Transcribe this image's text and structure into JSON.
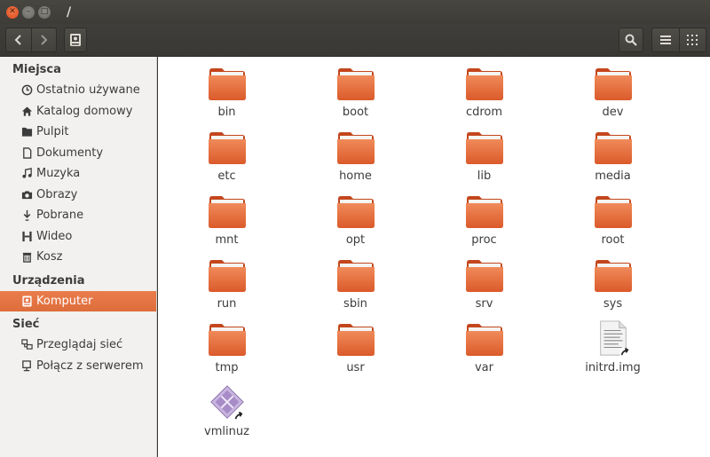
{
  "window": {
    "title": "/"
  },
  "sidebar": {
    "sections": [
      {
        "header": "Miejsca",
        "items": [
          {
            "label": "Ostatnio używane",
            "icon": "recent-icon"
          },
          {
            "label": "Katalog domowy",
            "icon": "home-icon"
          },
          {
            "label": "Pulpit",
            "icon": "desktop-folder-icon"
          },
          {
            "label": "Dokumenty",
            "icon": "document-icon"
          },
          {
            "label": "Muzyka",
            "icon": "music-icon"
          },
          {
            "label": "Obrazy",
            "icon": "camera-icon"
          },
          {
            "label": "Pobrane",
            "icon": "download-icon"
          },
          {
            "label": "Wideo",
            "icon": "video-icon"
          },
          {
            "label": "Kosz",
            "icon": "trash-icon"
          }
        ]
      },
      {
        "header": "Urządzenia",
        "items": [
          {
            "label": "Komputer",
            "icon": "computer-icon",
            "active": true
          }
        ]
      },
      {
        "header": "Sieć",
        "items": [
          {
            "label": "Przeglądaj sieć",
            "icon": "network-icon"
          },
          {
            "label": "Połącz z serwerem",
            "icon": "server-connect-icon"
          }
        ]
      }
    ]
  },
  "files": [
    {
      "name": "bin",
      "type": "folder"
    },
    {
      "name": "boot",
      "type": "folder"
    },
    {
      "name": "cdrom",
      "type": "folder"
    },
    {
      "name": "dev",
      "type": "folder"
    },
    {
      "name": "etc",
      "type": "folder"
    },
    {
      "name": "home",
      "type": "folder"
    },
    {
      "name": "lib",
      "type": "folder"
    },
    {
      "name": "media",
      "type": "folder"
    },
    {
      "name": "mnt",
      "type": "folder"
    },
    {
      "name": "opt",
      "type": "folder"
    },
    {
      "name": "proc",
      "type": "folder"
    },
    {
      "name": "root",
      "type": "folder"
    },
    {
      "name": "run",
      "type": "folder"
    },
    {
      "name": "sbin",
      "type": "folder"
    },
    {
      "name": "srv",
      "type": "folder"
    },
    {
      "name": "sys",
      "type": "folder"
    },
    {
      "name": "tmp",
      "type": "folder"
    },
    {
      "name": "usr",
      "type": "folder"
    },
    {
      "name": "var",
      "type": "folder"
    },
    {
      "name": "initrd.img",
      "type": "text-file-link"
    },
    {
      "name": "vmlinuz",
      "type": "binary-file-link"
    }
  ],
  "colors": {
    "accent": "#e4794d",
    "folder": "#e2673a",
    "toolbar": "#3c3b37"
  }
}
